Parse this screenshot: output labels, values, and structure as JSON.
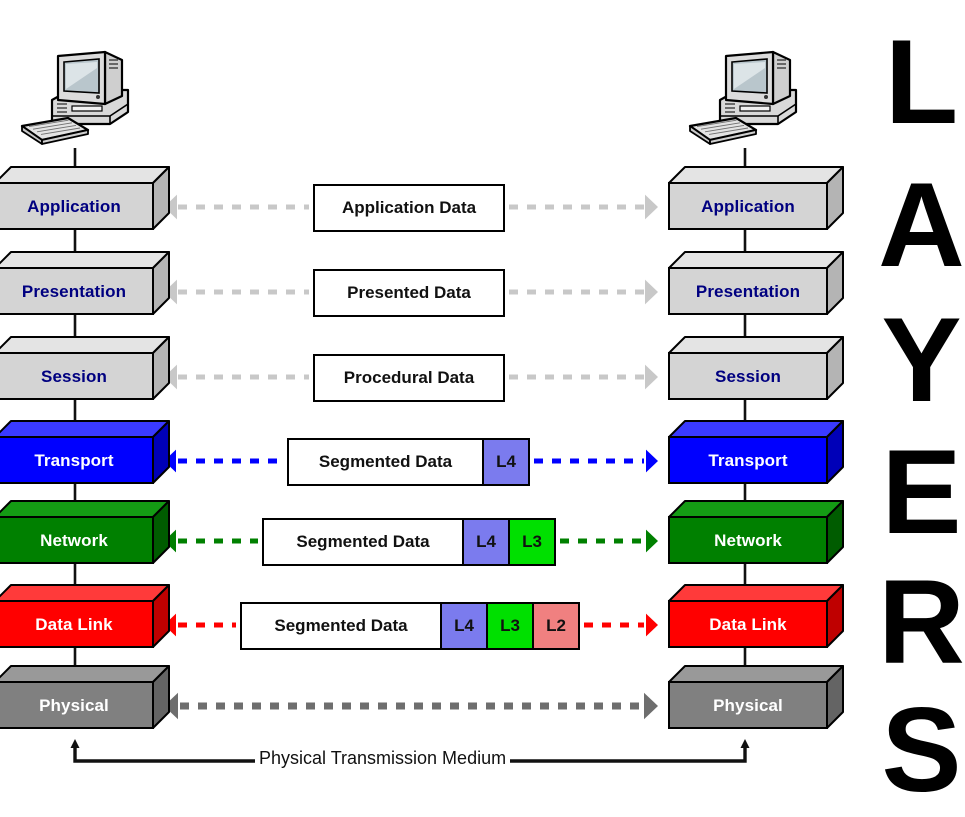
{
  "diagram": {
    "title_vertical": "LAYERS",
    "title_letters": [
      "L",
      "A",
      "Y",
      "E",
      "R",
      "S"
    ],
    "transmission_medium_label": "Physical Transmission Medium",
    "host_icon_name": "desktop-computer-icon"
  },
  "colors": {
    "grey_layer": "#d4d4d4",
    "grey_layer_top": "#e4e4e4",
    "grey_layer_side": "#b4b4b4",
    "blue_layer": "#0000ff",
    "blue_layer_top": "#3a3aff",
    "blue_layer_side": "#0000b8",
    "green_layer": "#008000",
    "green_layer_top": "#149b14",
    "green_layer_side": "#005c00",
    "red_layer": "#ff0000",
    "red_layer_top": "#ff3a3a",
    "red_layer_side": "#bf0000",
    "physical_layer": "#808080",
    "physical_layer_top": "#999999",
    "physical_layer_side": "#646464",
    "layer_text_dark": "#000080",
    "layer_text_light": "#ffffff",
    "arrow_grey": "#c8c8c8",
    "arrow_dark_grey": "#6e6e6e",
    "l4_fill": "#7b7bee",
    "l3_fill": "#00e000",
    "l2_fill": "#f08080"
  },
  "layers": [
    {
      "name": "Application",
      "text_color": "#000080",
      "fill": "#d4d4d4",
      "top": "#e4e4e4",
      "side": "#b4b4b4"
    },
    {
      "name": "Presentation",
      "text_color": "#000080",
      "fill": "#d4d4d4",
      "top": "#e4e4e4",
      "side": "#b4b4b4"
    },
    {
      "name": "Session",
      "text_color": "#000080",
      "fill": "#d4d4d4",
      "top": "#e4e4e4",
      "side": "#b4b4b4"
    },
    {
      "name": "Transport",
      "text_color": "#ffffff",
      "fill": "#0000ff",
      "top": "#3a3aff",
      "side": "#0000b8"
    },
    {
      "name": "Network",
      "text_color": "#ffffff",
      "fill": "#008000",
      "top": "#149b14",
      "side": "#005c00"
    },
    {
      "name": "Data Link",
      "text_color": "#ffffff",
      "fill": "#ff0000",
      "top": "#ff3a3a",
      "side": "#bf0000"
    },
    {
      "name": "Physical",
      "text_color": "#ffffff",
      "fill": "#808080",
      "top": "#999999",
      "side": "#646464"
    }
  ],
  "pdus": [
    {
      "label": "Application Data",
      "segments": [],
      "arrow_color": "#c8c8c8"
    },
    {
      "label": "Presented Data",
      "segments": [],
      "arrow_color": "#c8c8c8"
    },
    {
      "label": "Procedural Data",
      "segments": [],
      "arrow_color": "#c8c8c8"
    },
    {
      "label": "Segmented Data",
      "segments": [
        "L4"
      ],
      "arrow_color": "#0000ff"
    },
    {
      "label": "Segmented Data",
      "segments": [
        "L4",
        "L3"
      ],
      "arrow_color": "#008000"
    },
    {
      "label": "Segmented Data",
      "segments": [
        "L4",
        "L3",
        "L2"
      ],
      "arrow_color": "#ff0000"
    },
    {
      "label": "",
      "segments": [],
      "arrow_color": "#6e6e6e"
    }
  ],
  "segment_fills": {
    "L4": "#7b7bee",
    "L3": "#00e000",
    "L2": "#f08080"
  }
}
